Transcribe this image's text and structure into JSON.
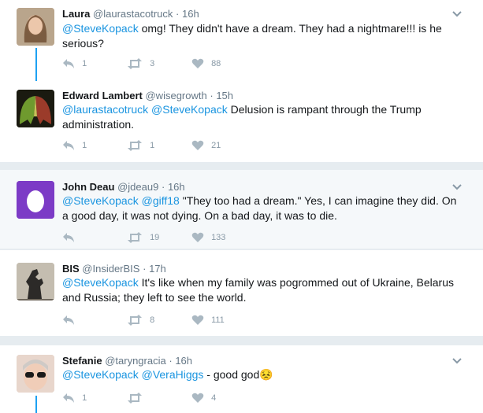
{
  "tweets": [
    {
      "name": "Laura",
      "handle": "@laurastacotruck",
      "sep": "·",
      "time": "16h",
      "mentions": [
        "@SteveKopack"
      ],
      "text": " omg! They didn't have a dream. They had a nightmare!!! is he serious?",
      "reply_count": "1",
      "retweet_count": "3",
      "like_count": "88",
      "avatar_icon": "user-photo-icon"
    },
    {
      "name": "Edward Lambert",
      "handle": "@wisegrowth",
      "sep": "·",
      "time": "15h",
      "mentions": [
        "@laurastacotruck",
        "@SteveKopack"
      ],
      "text": " Delusion is rampant through the Trump administration.",
      "reply_count": "1",
      "retweet_count": "1",
      "like_count": "21",
      "avatar_icon": "wings-avatar-icon"
    },
    {
      "name": "John Deau",
      "handle": "@jdeau9",
      "sep": "·",
      "time": "16h",
      "mentions": [
        "@SteveKopack",
        "@giff18"
      ],
      "text": " \"They too had a dream.\"  Yes, I can imagine they did. On a good day, it was not dying. On a bad day, it was to die.",
      "reply_count": "",
      "retweet_count": "19",
      "like_count": "133",
      "avatar_icon": "egg-avatar-icon"
    },
    {
      "name": "BIS",
      "handle": "@InsiderBIS",
      "sep": "·",
      "time": "17h",
      "mentions": [
        "@SteveKopack"
      ],
      "text": " It's like when my family was pogrommed out of Ukraine, Belarus and Russia; they left to see the world.",
      "reply_count": "",
      "retweet_count": "8",
      "like_count": "111",
      "avatar_icon": "godzilla-avatar-icon"
    },
    {
      "name": "Stefanie",
      "handle": "@taryngracia",
      "sep": "·",
      "time": "16h",
      "mentions": [
        "@SteveKopack",
        "@VeraHiggs"
      ],
      "text": " - good god",
      "emoji": "😣",
      "reply_count": "1",
      "retweet_count": "",
      "like_count": "4",
      "avatar_icon": "sunglasses-avatar-icon"
    }
  ],
  "icons": {
    "reply": "reply-icon",
    "retweet": "retweet-icon",
    "like": "heart-icon",
    "more": "chevron-down-icon"
  },
  "colors": {
    "link": "#1b95e0",
    "thread_line": "#1da1f2",
    "action": "#aab8c2",
    "separator": "#e6ecf0"
  }
}
